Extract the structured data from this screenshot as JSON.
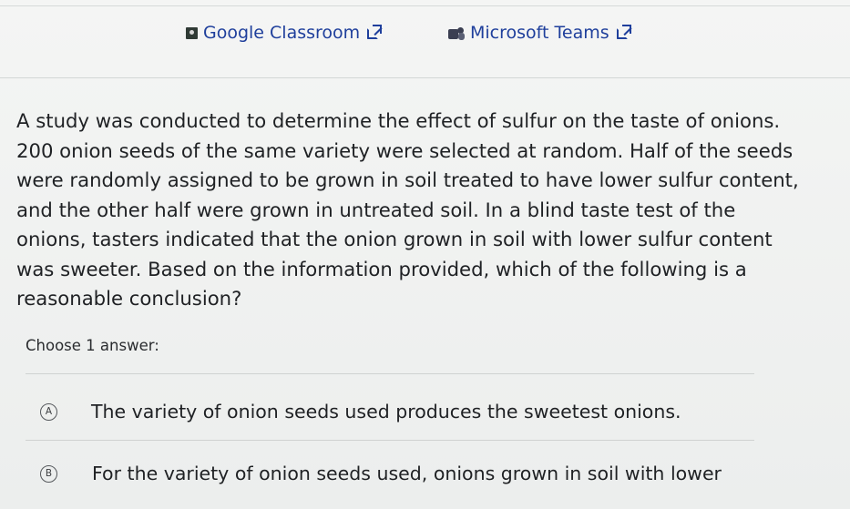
{
  "share": {
    "classroom_label": "Google Classroom",
    "teams_label": "Microsoft Teams"
  },
  "question": {
    "text": "A study was conducted to determine the effect of sulfur on the taste of onions. 200 onion seeds of the same variety were selected at random. Half of the seeds were randomly assigned to be grown in soil treated to have lower sulfur content, and the other half were grown in untreated soil. In a blind taste test of the onions, tasters indicated that the onion grown in soil with lower sulfur content was sweeter. Based on the information provided, which of the following is a reasonable conclusion?"
  },
  "answers": {
    "prompt": "Choose 1 answer:",
    "options": [
      {
        "letter": "A",
        "text": "The variety of onion seeds used produces the sweetest onions."
      },
      {
        "letter": "B",
        "text": "For the variety of onion seeds used, onions grown in soil with lower"
      }
    ]
  },
  "icons": {
    "classroom": "google-classroom-icon",
    "teams": "microsoft-teams-icon",
    "external": "external-link-icon"
  }
}
